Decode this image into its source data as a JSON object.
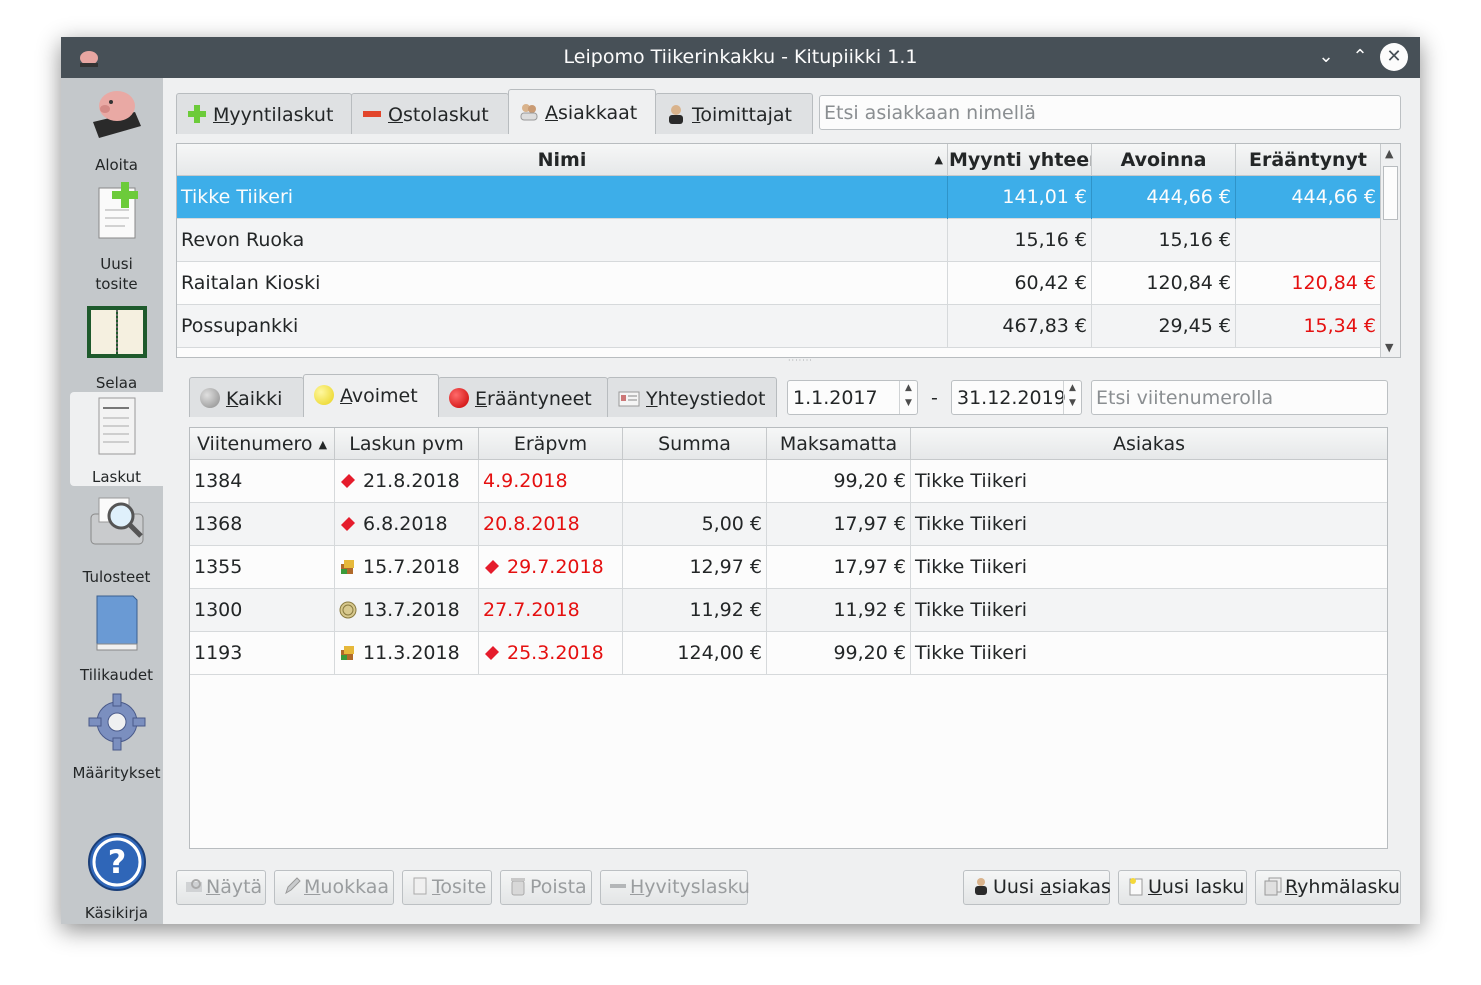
{
  "window": {
    "title": "Leipomo Tiikerinkakku - Kitupiikki 1.1"
  },
  "sidebar": {
    "items": [
      {
        "label": "Aloita",
        "icon": "piggy-bank-icon"
      },
      {
        "label": "Uusi tosite",
        "icon": "new-document-icon"
      },
      {
        "label": "Selaa",
        "icon": "ledger-book-icon"
      },
      {
        "label": "Laskut",
        "icon": "invoice-icon"
      },
      {
        "label": "Tulosteet",
        "icon": "print-preview-icon"
      },
      {
        "label": "Tilikaudet",
        "icon": "blue-book-icon"
      },
      {
        "label": "Määritykset",
        "icon": "gear-icon"
      },
      {
        "label": "Käsikirja",
        "icon": "help-icon"
      }
    ]
  },
  "top_tabs": [
    {
      "label": "Myyntilaskut",
      "mnemonic": "M",
      "rest": "yyntilaskut",
      "icon": "plus-icon"
    },
    {
      "label": "Ostolaskut",
      "mnemonic": "O",
      "rest": "stolaskut",
      "icon": "minus-icon"
    },
    {
      "label": "Asiakkaat",
      "mnemonic": "A",
      "rest": "siakkaat",
      "icon": "customers-icon"
    },
    {
      "label": "Toimittajat",
      "mnemonic": "T",
      "rest": "oimittajat",
      "icon": "supplier-icon"
    }
  ],
  "customer_search": {
    "placeholder": "Etsi asiakkaan nimellä"
  },
  "customers_table": {
    "columns": [
      "Nimi",
      "Myynti yhteensä",
      "Avoinna",
      "Erääntynyt"
    ],
    "rows": [
      {
        "name": "Tikke Tiikeri",
        "sales": "141,01 €",
        "open": "444,66 €",
        "overdue": "444,66 €",
        "selected": true
      },
      {
        "name": "Revon Ruoka",
        "sales": "15,16 €",
        "open": "15,16 €",
        "overdue": ""
      },
      {
        "name": "Raitalan Kioski",
        "sales": "60,42 €",
        "open": "120,84 €",
        "overdue": "120,84 €"
      },
      {
        "name": "Possupankki",
        "sales": "467,83 €",
        "open": "29,45 €",
        "overdue": "15,34 €"
      }
    ]
  },
  "filter_tabs": [
    {
      "label": "Kaikki",
      "mnemonic": "K",
      "rest": "aikki",
      "color": "#9a9d9f"
    },
    {
      "label": "Avoimet",
      "mnemonic": "A",
      "rest": "voimet",
      "color": "#f4e33a"
    },
    {
      "label": "Erääntyneet",
      "mnemonic": "E",
      "rest": "rääntyneet",
      "color": "#e51010"
    },
    {
      "label": "Yhteystiedot",
      "mnemonic": "Y",
      "rest": "hteystiedot",
      "icon": "contact-card-icon"
    }
  ],
  "date_from": "1.1.2017",
  "date_separator": "-",
  "date_to": "31.12.2019",
  "reference_search": {
    "placeholder": "Etsi viitenumerolla"
  },
  "invoices_table": {
    "columns": [
      "Viitenumero",
      "Laskun pvm",
      "Eräpvm",
      "Summa",
      "Maksamatta",
      "Asiakas"
    ],
    "rows": [
      {
        "ref": "1384",
        "status_icon": "red-ticket-icon",
        "date": "21.8.2018",
        "due": "4.9.2018",
        "due_icon": "",
        "sum": "",
        "unpaid": "99,20 €",
        "customer": "Tikke Tiikeri"
      },
      {
        "ref": "1368",
        "status_icon": "red-ticket-icon",
        "date": "6.8.2018",
        "due": "20.8.2018",
        "due_icon": "",
        "sum": "5,00 €",
        "unpaid": "17,97 €",
        "customer": "Tikke Tiikeri"
      },
      {
        "ref": "1355",
        "status_icon": "boxes-icon",
        "date": "15.7.2018",
        "due": "29.7.2018",
        "due_icon": "red-ticket-icon",
        "sum": "12,97 €",
        "unpaid": "17,97 €",
        "customer": "Tikke Tiikeri"
      },
      {
        "ref": "1300",
        "status_icon": "coin-icon",
        "date": "13.7.2018",
        "due": "27.7.2018",
        "due_icon": "",
        "sum": "11,92 €",
        "unpaid": "11,92 €",
        "customer": "Tikke Tiikeri"
      },
      {
        "ref": "1193",
        "status_icon": "boxes-icon",
        "date": "11.3.2018",
        "due": "25.3.2018",
        "due_icon": "red-ticket-icon",
        "sum": "124,00 €",
        "unpaid": "99,20 €",
        "customer": "Tikke Tiikeri"
      }
    ]
  },
  "buttons": {
    "show": {
      "label": "Näytä",
      "mnemonic": "N",
      "rest": "äytä"
    },
    "edit": {
      "label": "Muokkaa",
      "mnemonic": "M",
      "rest": "uokkaa"
    },
    "voucher": {
      "label": "Tosite",
      "mnemonic": "T",
      "rest": "osite"
    },
    "delete": {
      "label": "Poista"
    },
    "credit": {
      "label": "Hyvityslasku",
      "mnemonic": "H",
      "rest": "yvityslasku"
    },
    "new_customer": {
      "label": "Uusi asiakas",
      "pre": "Uusi ",
      "mnemonic": "a",
      "rest": "siakas"
    },
    "new_invoice": {
      "label": "Uusi lasku",
      "mnemonic": "U",
      "rest": "usi lasku"
    },
    "group_invoice": {
      "label": "Ryhmälasku",
      "mnemonic": "R",
      "rest": "yhmälasku"
    }
  },
  "colors": {
    "selection": "#3daee9",
    "overdue_red": "#e51010",
    "titlebar": "#475057"
  }
}
